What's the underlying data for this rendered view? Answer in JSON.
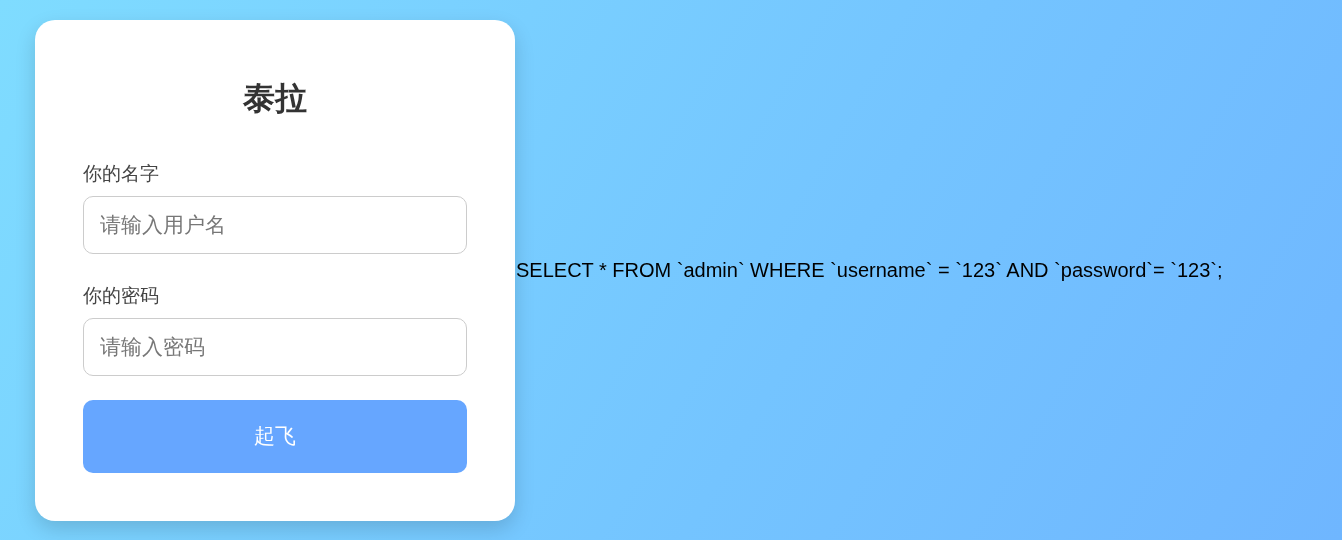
{
  "login_card": {
    "title": "泰拉",
    "fields": [
      {
        "label": "你的名字",
        "placeholder": "请输入用户名"
      },
      {
        "label": "你的密码",
        "placeholder": "请输入密码"
      }
    ],
    "button": "起飞"
  },
  "query_text": "SELECT * FROM `admin` WHERE `username` = `123` AND `password`= `123`;"
}
